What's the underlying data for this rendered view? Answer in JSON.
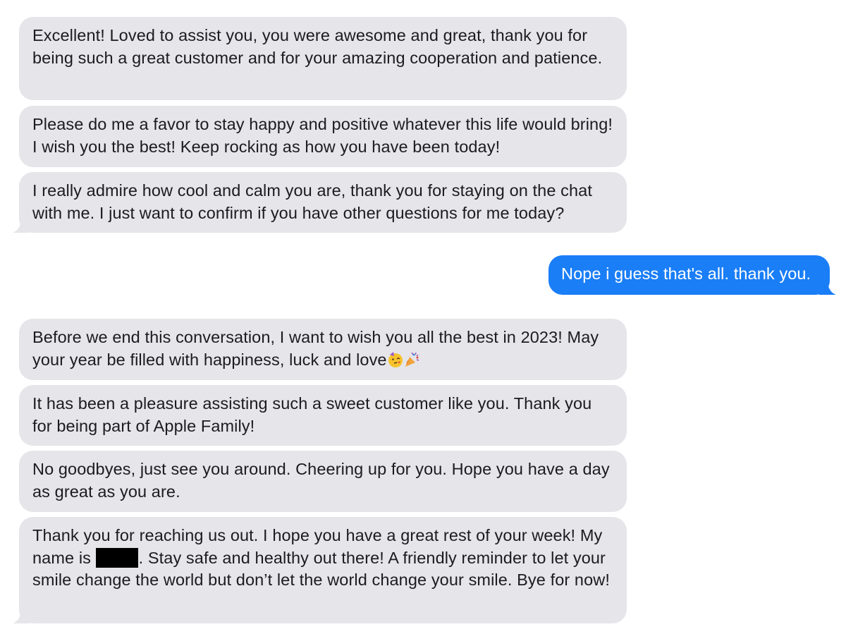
{
  "colors": {
    "received_bubble": "#e5e5ea",
    "sent_bubble": "#1a7ef7",
    "received_text": "#1c1c1e",
    "sent_text": "#ffffff"
  },
  "messages": [
    {
      "from": "agent",
      "text": "Excellent! Loved to assist you, you were awesome and great, thank you for being such a great customer and for your amazing cooperation and patience."
    },
    {
      "from": "agent",
      "text": "Please do me a favor to stay happy and positive whatever this life would bring! I wish you the best! Keep rocking as how you have been today!"
    },
    {
      "from": "agent",
      "text": "I really admire how cool and calm you are, thank you for staying on the chat with me. I just want to confirm if you have other questions for me today?"
    },
    {
      "from": "user",
      "text": "Nope i guess that's all. thank you."
    },
    {
      "from": "agent",
      "text": "Before we end this conversation, I want to wish you all the best in 2023! May your year be filled with happiness, luck and love",
      "emojis": [
        "partying-face-emoji",
        "party-popper-emoji"
      ]
    },
    {
      "from": "agent",
      "text": "It has been a pleasure assisting such a sweet customer like you. Thank you for being part of Apple Family!"
    },
    {
      "from": "agent",
      "text": "No goodbyes, just see you around. Cheering up for you. Hope you have a day as great as you are."
    },
    {
      "from": "agent",
      "text_before": "Thank you for reaching us out. I hope you have a great rest of your week! My name is ",
      "redacted": true,
      "text_after": ". Stay safe and healthy out there! A friendly reminder to let your smile change the world but don’t let the world change your smile. Bye for now!"
    }
  ]
}
